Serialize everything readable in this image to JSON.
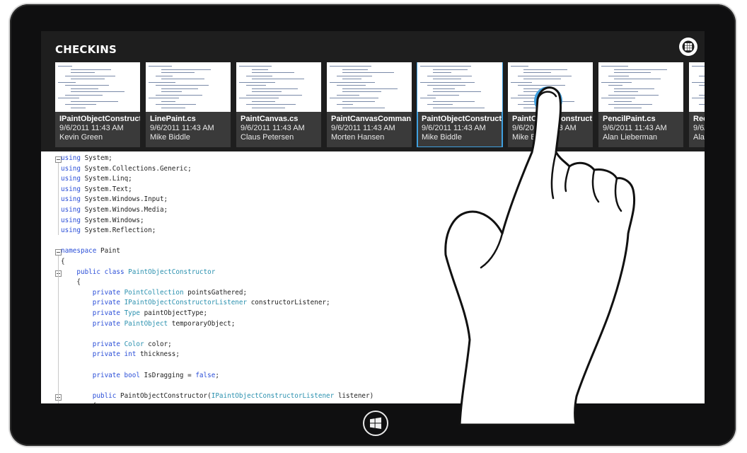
{
  "header": {
    "title": "CHECKINS"
  },
  "checkins": [
    {
      "file": "IPaintObjectConstruct",
      "date": "9/6/2011 11:43 AM",
      "author": "Kevin Green",
      "selected": false
    },
    {
      "file": "LinePaint.cs",
      "date": "9/6/2011 11:43 AM",
      "author": "Mike Biddle",
      "selected": false
    },
    {
      "file": "PaintCanvas.cs",
      "date": "9/6/2011 11:43 AM",
      "author": "Claus Petersen",
      "selected": false
    },
    {
      "file": "PaintCanvasComman",
      "date": "9/6/2011 11:43 AM",
      "author": "Morten Hansen",
      "selected": false
    },
    {
      "file": "PaintObjectConstruct",
      "date": "9/6/2011 11:43 AM",
      "author": "Mike Biddle",
      "selected": true
    },
    {
      "file": "PaintObjectConstruct",
      "date": "9/6/2011 11:43 AM",
      "author": "Mike Biddle",
      "selected": false
    },
    {
      "file": "PencilPaint.cs",
      "date": "9/6/2011 11:43 AM",
      "author": "Alan Lieberman",
      "selected": false
    },
    {
      "file": "Rec",
      "date": "9/6/",
      "author": "Alan",
      "selected": false
    }
  ],
  "code_lines": [
    [
      [
        "kw",
        "using"
      ],
      [
        "t",
        " System;"
      ]
    ],
    [
      [
        "kw",
        "using"
      ],
      [
        "t",
        " System.Collections.Generic;"
      ]
    ],
    [
      [
        "kw",
        "using"
      ],
      [
        "t",
        " System.Linq;"
      ]
    ],
    [
      [
        "kw",
        "using"
      ],
      [
        "t",
        " System.Text;"
      ]
    ],
    [
      [
        "kw",
        "using"
      ],
      [
        "t",
        " System.Windows.Input;"
      ]
    ],
    [
      [
        "kw",
        "using"
      ],
      [
        "t",
        " System.Windows.Media;"
      ]
    ],
    [
      [
        "kw",
        "using"
      ],
      [
        "t",
        " System.Windows;"
      ]
    ],
    [
      [
        "kw",
        "using"
      ],
      [
        "t",
        " System.Reflection;"
      ]
    ],
    [],
    [
      [
        "kw",
        "namespace"
      ],
      [
        "t",
        " Paint"
      ]
    ],
    [
      [
        "t",
        "{"
      ]
    ],
    [
      [
        "t",
        "    "
      ],
      [
        "kw",
        "public class"
      ],
      [
        "t",
        " "
      ],
      [
        "ty",
        "PaintObjectConstructor"
      ]
    ],
    [
      [
        "t",
        "    {"
      ]
    ],
    [
      [
        "t",
        "        "
      ],
      [
        "kw",
        "private"
      ],
      [
        "t",
        " "
      ],
      [
        "ty",
        "PointCollection"
      ],
      [
        "t",
        " pointsGathered;"
      ]
    ],
    [
      [
        "t",
        "        "
      ],
      [
        "kw",
        "private"
      ],
      [
        "t",
        " "
      ],
      [
        "ty",
        "IPaintObjectConstructorListener"
      ],
      [
        "t",
        " constructorListener;"
      ]
    ],
    [
      [
        "t",
        "        "
      ],
      [
        "kw",
        "private"
      ],
      [
        "t",
        " "
      ],
      [
        "ty",
        "Type"
      ],
      [
        "t",
        " paintObjectType;"
      ]
    ],
    [
      [
        "t",
        "        "
      ],
      [
        "kw",
        "private"
      ],
      [
        "t",
        " "
      ],
      [
        "ty",
        "PaintObject"
      ],
      [
        "t",
        " temporaryObject;"
      ]
    ],
    [],
    [
      [
        "t",
        "        "
      ],
      [
        "kw",
        "private"
      ],
      [
        "t",
        " "
      ],
      [
        "ty",
        "Color"
      ],
      [
        "t",
        " color;"
      ]
    ],
    [
      [
        "t",
        "        "
      ],
      [
        "kw",
        "private int"
      ],
      [
        "t",
        " thickness;"
      ]
    ],
    [],
    [
      [
        "t",
        "        "
      ],
      [
        "kw",
        "private bool"
      ],
      [
        "t",
        " IsDragging = "
      ],
      [
        "kw",
        "false"
      ],
      [
        "t",
        ";"
      ]
    ],
    [],
    [
      [
        "t",
        "        "
      ],
      [
        "kw",
        "public"
      ],
      [
        "t",
        " PaintObjectConstructor("
      ],
      [
        "ty",
        "IPaintObjectConstructorListener"
      ],
      [
        "t",
        " listener)"
      ]
    ],
    [
      [
        "t",
        "        {"
      ]
    ]
  ],
  "icons": {
    "grid": "grid-view-icon",
    "windows": "windows-logo-icon",
    "hand": "touch-hand-icon"
  },
  "colors": {
    "topbar": "#1e1e1e",
    "selected_outline": "#3fa0e0",
    "keyword": "#2b4fd8",
    "type": "#2b91af",
    "touch_point": "#3fa0e0"
  }
}
